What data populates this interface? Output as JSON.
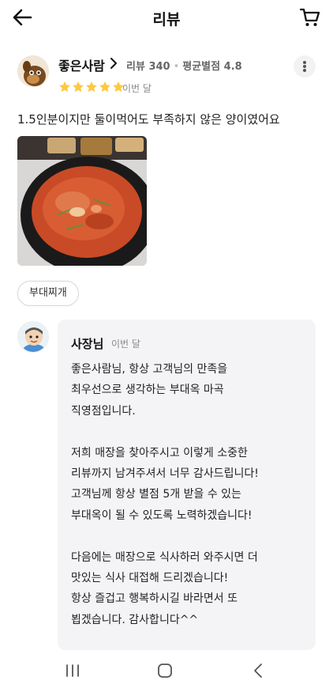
{
  "header": {
    "title": "리뷰",
    "back_icon": "back-arrow-icon",
    "cart_icon": "cart-icon"
  },
  "reviewer": {
    "nickname": "좋은사람",
    "review_count": "리뷰 340",
    "avg_rating": "평균별점 4.8",
    "rating": 5,
    "date": "이번 달"
  },
  "review": {
    "text": "1.5인분이지만 둘이먹어도 부족하지 않은 양이였어요",
    "menu_tag": "부대찌개"
  },
  "reply": {
    "author": "사장님",
    "date": "이번 달",
    "lines": [
      "좋은사람님,  항상 고객님의 만족을",
      "최우선으로 생각하는 부대옥 마곡",
      "직영점입니다.",
      "",
      "저희 매장을 찾아주시고 이렇게 소중한",
      "리뷰까지 남겨주셔서 너무 감사드립니다!",
      "고객님께 항상 별점 5개 받을 수 있는",
      "부대옥이 될 수 있도록 노력하겠습니다!",
      "",
      "다음에는 매장으로 식사하러 와주시면 더",
      "맛있는 식사 대접해 드리겠습니다!",
      "항상 즐겁고 행복하시길 바라면서 또",
      "뵙겠습니다. 감사합니다^^"
    ]
  },
  "colors": {
    "star": "#ffc83d",
    "reply_bg": "#f4f4f6",
    "text": "#222222",
    "muted": "#888888"
  },
  "navbar": {
    "icons": [
      "recent-apps-icon",
      "home-icon",
      "nav-back-icon"
    ]
  }
}
